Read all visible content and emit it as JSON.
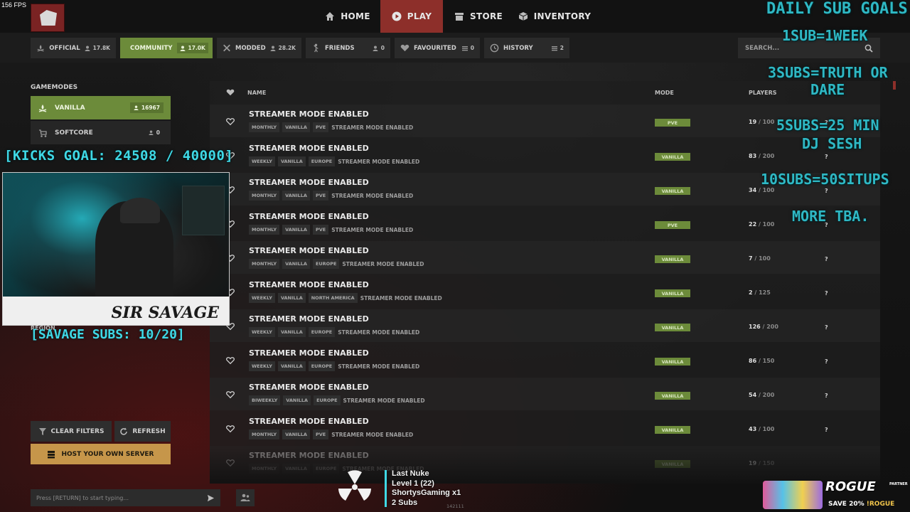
{
  "fps": "156 FPS",
  "nav": {
    "home": "HOME",
    "play": "PLAY",
    "store": "STORE",
    "inventory": "INVENTORY"
  },
  "tabs": [
    {
      "label": "OFFICIAL",
      "count": "17.8K"
    },
    {
      "label": "COMMUNITY",
      "count": "17.0K"
    },
    {
      "label": "MODDED",
      "count": "28.2K"
    },
    {
      "label": "FRIENDS",
      "count": "0"
    },
    {
      "label": "FAVOURITED",
      "count": "0"
    },
    {
      "label": "HISTORY",
      "count": "2"
    }
  ],
  "search": {
    "placeholder": "SEARCH..."
  },
  "gamemodes": {
    "title": "GAMEMODES",
    "items": [
      {
        "label": "VANILLA",
        "count": "16967"
      },
      {
        "label": "SOFTCORE",
        "count": "0"
      }
    ]
  },
  "region_label": "REGION",
  "overlay": {
    "kicks_goal": "[KICKS GOAL: 24508 / 40000]",
    "savage_subs": "[SAVAGE SUBS: 10/20]",
    "webcam_banner": "SIR SAVAGE",
    "daily_title": "DAILY SUB GOALS",
    "goal_1": "1SUB=1WEEK",
    "goal_2a": "3SUBS=TRUTH OR",
    "goal_2b": "DARE",
    "goal_3a": "5SUBS=25 MIN",
    "goal_3b": "DJ SESH",
    "goal_4": "10SUBS=50SITUPS",
    "goal_5": "MORE TBA."
  },
  "list": {
    "headers": {
      "name": "NAME",
      "mode": "MODE",
      "players": "PLAYERS"
    },
    "rows": [
      {
        "name": "STREAMER MODE ENABLED",
        "tags": [
          "MONTHLY",
          "VANILLA",
          "PVE"
        ],
        "desc": "STREAMER MODE ENABLED",
        "mode": "PVE",
        "players": "19",
        "max": "/ 100",
        "ping": "?"
      },
      {
        "name": "STREAMER MODE ENABLED",
        "tags": [
          "WEEKLY",
          "VANILLA",
          "EUROPE"
        ],
        "desc": "STREAMER MODE ENABLED",
        "mode": "VANILLA",
        "players": "83",
        "max": "/ 200",
        "ping": "?"
      },
      {
        "name": "STREAMER MODE ENABLED",
        "tags": [
          "MONTHLY",
          "VANILLA",
          "PVE"
        ],
        "desc": "STREAMER MODE ENABLED",
        "mode": "VANILLA",
        "players": "34",
        "max": "/ 100",
        "ping": "?"
      },
      {
        "name": "STREAMER MODE ENABLED",
        "tags": [
          "MONTHLY",
          "VANILLA",
          "PVE"
        ],
        "desc": "STREAMER MODE ENABLED",
        "mode": "PVE",
        "players": "22",
        "max": "/ 100",
        "ping": "?"
      },
      {
        "name": "STREAMER MODE ENABLED",
        "tags": [
          "MONTHLY",
          "VANILLA",
          "EUROPE"
        ],
        "desc": "STREAMER MODE ENABLED",
        "mode": "VANILLA",
        "players": "7",
        "max": "/ 100",
        "ping": "?"
      },
      {
        "name": "STREAMER MODE ENABLED",
        "tags": [
          "WEEKLY",
          "VANILLA",
          "NORTH AMERICA"
        ],
        "desc": "STREAMER MODE ENABLED",
        "mode": "VANILLA",
        "players": "2",
        "max": "/ 125",
        "ping": "?"
      },
      {
        "name": "STREAMER MODE ENABLED",
        "tags": [
          "WEEKLY",
          "VANILLA",
          "EUROPE"
        ],
        "desc": "STREAMER MODE ENABLED",
        "mode": "VANILLA",
        "players": "126",
        "max": "/ 200",
        "ping": "?"
      },
      {
        "name": "STREAMER MODE ENABLED",
        "tags": [
          "WEEKLY",
          "VANILLA",
          "EUROPE"
        ],
        "desc": "STREAMER MODE ENABLED",
        "mode": "VANILLA",
        "players": "86",
        "max": "/ 150",
        "ping": "?"
      },
      {
        "name": "STREAMER MODE ENABLED",
        "tags": [
          "BIWEEKLY",
          "VANILLA",
          "EUROPE"
        ],
        "desc": "STREAMER MODE ENABLED",
        "mode": "VANILLA",
        "players": "54",
        "max": "/ 200",
        "ping": "?"
      },
      {
        "name": "STREAMER MODE ENABLED",
        "tags": [
          "MONTHLY",
          "VANILLA",
          "PVE"
        ],
        "desc": "STREAMER MODE ENABLED",
        "mode": "VANILLA",
        "players": "43",
        "max": "/ 100",
        "ping": "?"
      },
      {
        "name": "STREAMER MODE ENABLED",
        "tags": [
          "MONTHLY",
          "VANILLA",
          "EUROPE"
        ],
        "desc": "STREAMER MODE ENABLED",
        "mode": "VANILLA",
        "players": "19",
        "max": "/ 150",
        "ping": ""
      }
    ]
  },
  "buttons": {
    "clear_filters": "CLEAR FILTERS",
    "refresh": "REFRESH",
    "host": "HOST YOUR OWN SERVER"
  },
  "chat": {
    "placeholder": "Press [RETURN] to start typing..."
  },
  "alert": {
    "line1": "Last Nuke",
    "line2": "Level 1  (22)",
    "line3": "ShortysGaming x1",
    "line4": "2 Subs"
  },
  "tiny_text": "142111",
  "rogue": {
    "brand": "ROGUE",
    "partner": "PARTNER",
    "promo": "SAVE 20%",
    "code": "!ROGUE"
  },
  "colors": {
    "accent_green": "#6c8b3a",
    "accent_red": "#8d2f2a",
    "overlay_cyan": "#3fd9e6",
    "host_gold": "#c6964a"
  }
}
